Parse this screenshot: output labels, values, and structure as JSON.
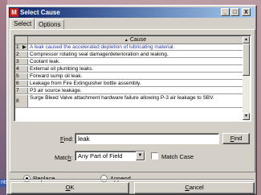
{
  "window": {
    "title": "Select Cause",
    "app_icon_letter": "M",
    "minimize": "_",
    "restore": "□",
    "close": "X"
  },
  "tabs": [
    "Select",
    "Options"
  ],
  "grid": {
    "column_header": "Cause",
    "rows": [
      {
        "num": "1",
        "pointer": "▶",
        "text": "A leak caused the accelerated depletion of lubricating material."
      },
      {
        "num": "2",
        "pointer": "",
        "text": "Compressor rotating seal damage/deterioration and leaking."
      },
      {
        "num": "3",
        "pointer": "",
        "text": "Coolant leak."
      },
      {
        "num": "4",
        "pointer": "",
        "text": "External oil plumbing leaks."
      },
      {
        "num": "5",
        "pointer": "",
        "text": "Forward sump oil leak."
      },
      {
        "num": "6",
        "pointer": "",
        "text": "Leakage from Fire Extinguisher bottle assembly."
      },
      {
        "num": "7",
        "pointer": "",
        "text": "P3 air source leakage."
      },
      {
        "num": "8",
        "pointer": "",
        "text": "Surge Bleed Valve attachment hardware failure allowing P-3 air leakage to SBV."
      }
    ]
  },
  "find": {
    "label": "Find:",
    "value": "leak",
    "button": "Find"
  },
  "match": {
    "label": "Match:",
    "selected": "Any Part of Field",
    "match_case_label": "Match Case"
  },
  "mode": {
    "replace_label": "Replace",
    "append_label": "Append",
    "selected": "Replace"
  },
  "buttons": {
    "ok": "OK",
    "cancel": "Cancel"
  },
  "background": {
    "left_stub_text": "nts"
  }
}
